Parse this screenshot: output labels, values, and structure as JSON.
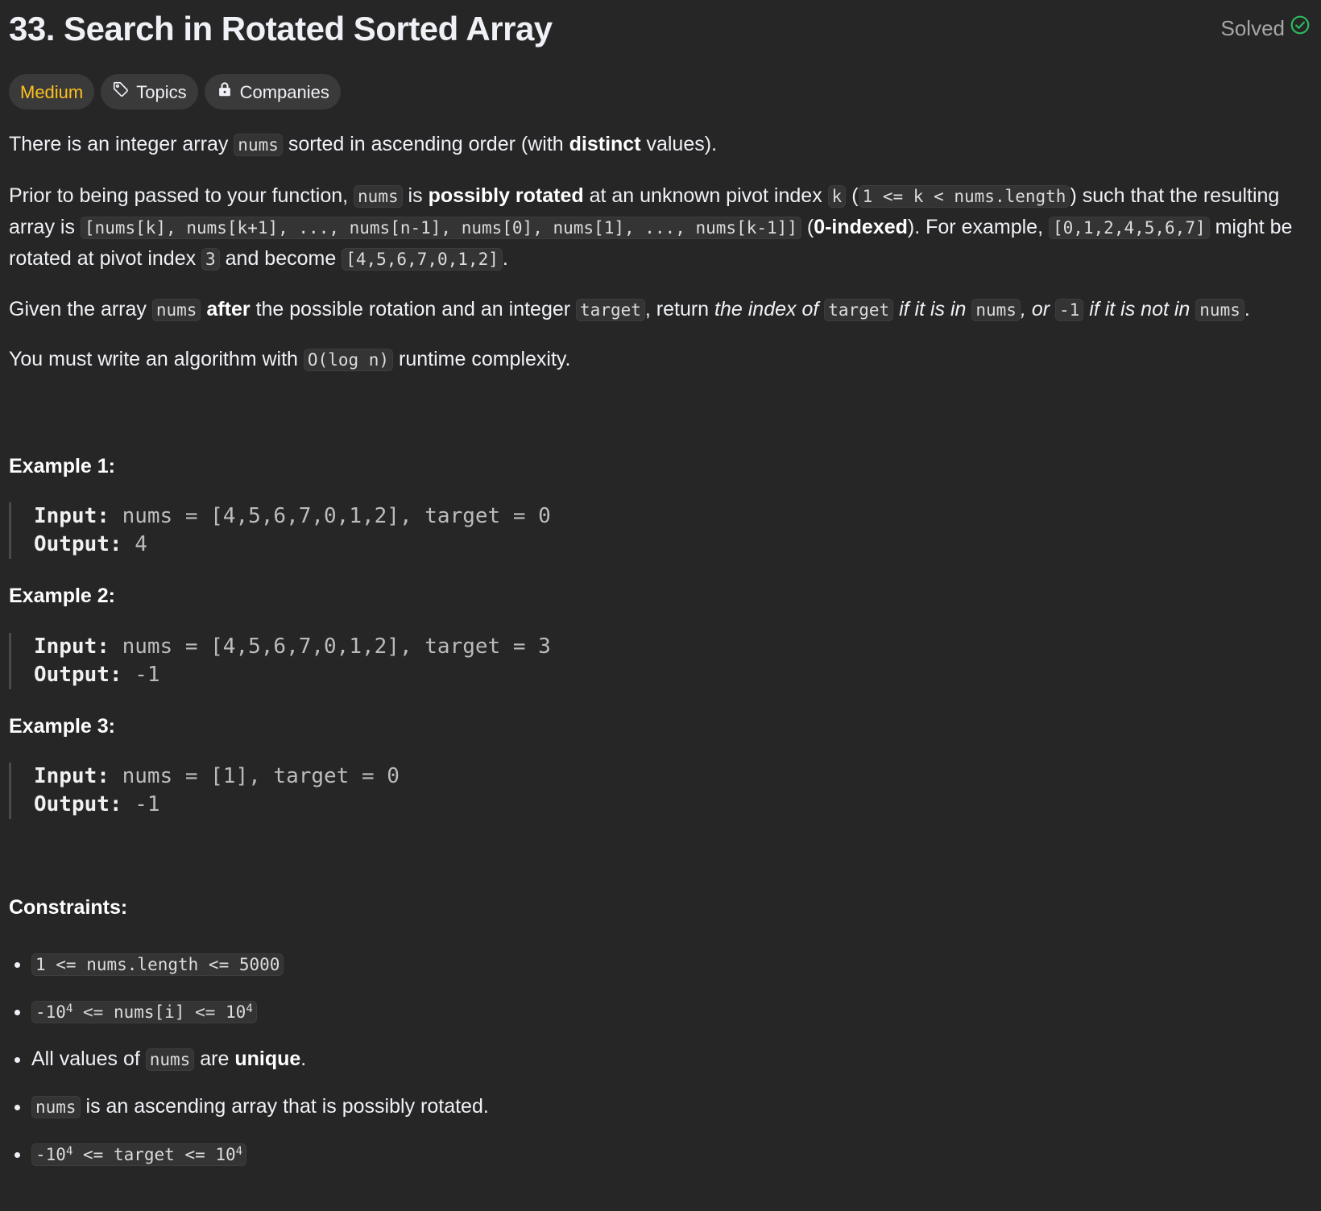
{
  "header": {
    "title": "33. Search in Rotated Sorted Array",
    "status": "Solved"
  },
  "badges": {
    "difficulty": "Medium",
    "topics": "Topics",
    "companies": "Companies"
  },
  "colors": {
    "background": "#262626",
    "difficulty_medium": "#ffc01e",
    "solved_check": "#2cbb5d"
  },
  "description": {
    "p1": [
      "There is an integer array ",
      "nums",
      " sorted in ascending order (with ",
      "distinct",
      " values)."
    ],
    "p2": [
      "Prior to being passed to your function, ",
      "nums",
      " is ",
      "possibly rotated",
      " at an unknown pivot index ",
      "k",
      " (",
      "1 <= k < nums.length",
      ") such that the resulting array is ",
      "[nums[k], nums[k+1], ..., nums[n-1], nums[0], nums[1], ..., nums[k-1]]",
      " (",
      "0-indexed",
      "). For example, ",
      "[0,1,2,4,5,6,7]",
      " might be rotated at pivot index ",
      "3",
      " and become ",
      "[4,5,6,7,0,1,2]",
      "."
    ],
    "p3": [
      "Given the array ",
      "nums",
      " ",
      "after",
      " the possible rotation and an integer ",
      "target",
      ", return ",
      "the index of ",
      "target",
      " if it is in ",
      "nums",
      ", or ",
      "-1",
      " if it is not in ",
      "nums",
      "."
    ],
    "p4": [
      "You must write an algorithm with ",
      "O(log n)",
      " runtime complexity."
    ]
  },
  "examples": [
    {
      "heading": "Example 1:",
      "input_label": "Input:",
      "input": "nums = [4,5,6,7,0,1,2], target = 0",
      "output_label": "Output:",
      "output": "4"
    },
    {
      "heading": "Example 2:",
      "input_label": "Input:",
      "input": "nums = [4,5,6,7,0,1,2], target = 3",
      "output_label": "Output:",
      "output": "-1"
    },
    {
      "heading": "Example 3:",
      "input_label": "Input:",
      "input": "nums = [1], target = 0",
      "output_label": "Output:",
      "output": "-1"
    }
  ],
  "constraints": {
    "heading": "Constraints:",
    "c1": "1 <= nums.length <= 5000",
    "c2": [
      "-10",
      "4",
      " <= nums[i] <= 10",
      "4"
    ],
    "c3": [
      "All values of ",
      "nums",
      " are ",
      "unique",
      "."
    ],
    "c4": [
      "nums",
      " is an ascending array that is possibly rotated."
    ],
    "c5": [
      "-10",
      "4",
      " <= target <= 10",
      "4"
    ]
  }
}
